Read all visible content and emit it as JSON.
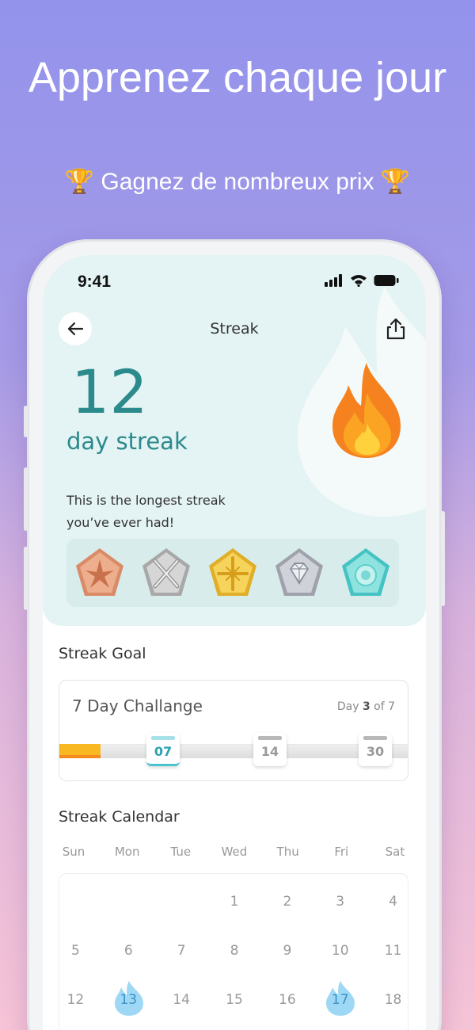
{
  "promo": {
    "title": "Apprenez chaque jour",
    "subtitle": "🏆 Gagnez de nombreux prix 🏆"
  },
  "status_bar": {
    "time": "9:41"
  },
  "nav": {
    "title": "Streak"
  },
  "streak": {
    "count": "12",
    "label": "day streak",
    "message": "This is the longest streak you’ve ever had!"
  },
  "badges": [
    {
      "name": "bronze-star-badge",
      "color": "#e2a080"
    },
    {
      "name": "silver-swords-badge",
      "color": "#c8c8c8"
    },
    {
      "name": "gold-cross-badge",
      "color": "#f2cc4f"
    },
    {
      "name": "diamond-badge",
      "color": "#c9ccd4"
    },
    {
      "name": "teal-gem-badge",
      "color": "#7ad8d6"
    }
  ],
  "goal": {
    "section_title": "Streak Goal",
    "challenge": "7 Day Challange",
    "day_prefix": "Day",
    "day_current": "3",
    "day_suffix": "of 7",
    "progress": 0.428,
    "milestones": [
      "07",
      "14",
      "30"
    ]
  },
  "calendar": {
    "section_title": "Streak Calendar",
    "weekdays": [
      "Sun",
      "Mon",
      "Tue",
      "Wed",
      "Thu",
      "Fri",
      "Sat"
    ],
    "days": [
      "",
      "",
      "",
      "1",
      "2",
      "3",
      "4",
      "5",
      "6",
      "7",
      "8",
      "9",
      "10",
      "11",
      "12",
      "13",
      "14",
      "15",
      "16",
      "17",
      "18"
    ],
    "streak_days": [
      "13",
      "17"
    ]
  },
  "colors": {
    "accent_teal": "#2b8a8c",
    "progress_yellow": "#f7b821",
    "flame_orange": "#f58a1e"
  }
}
